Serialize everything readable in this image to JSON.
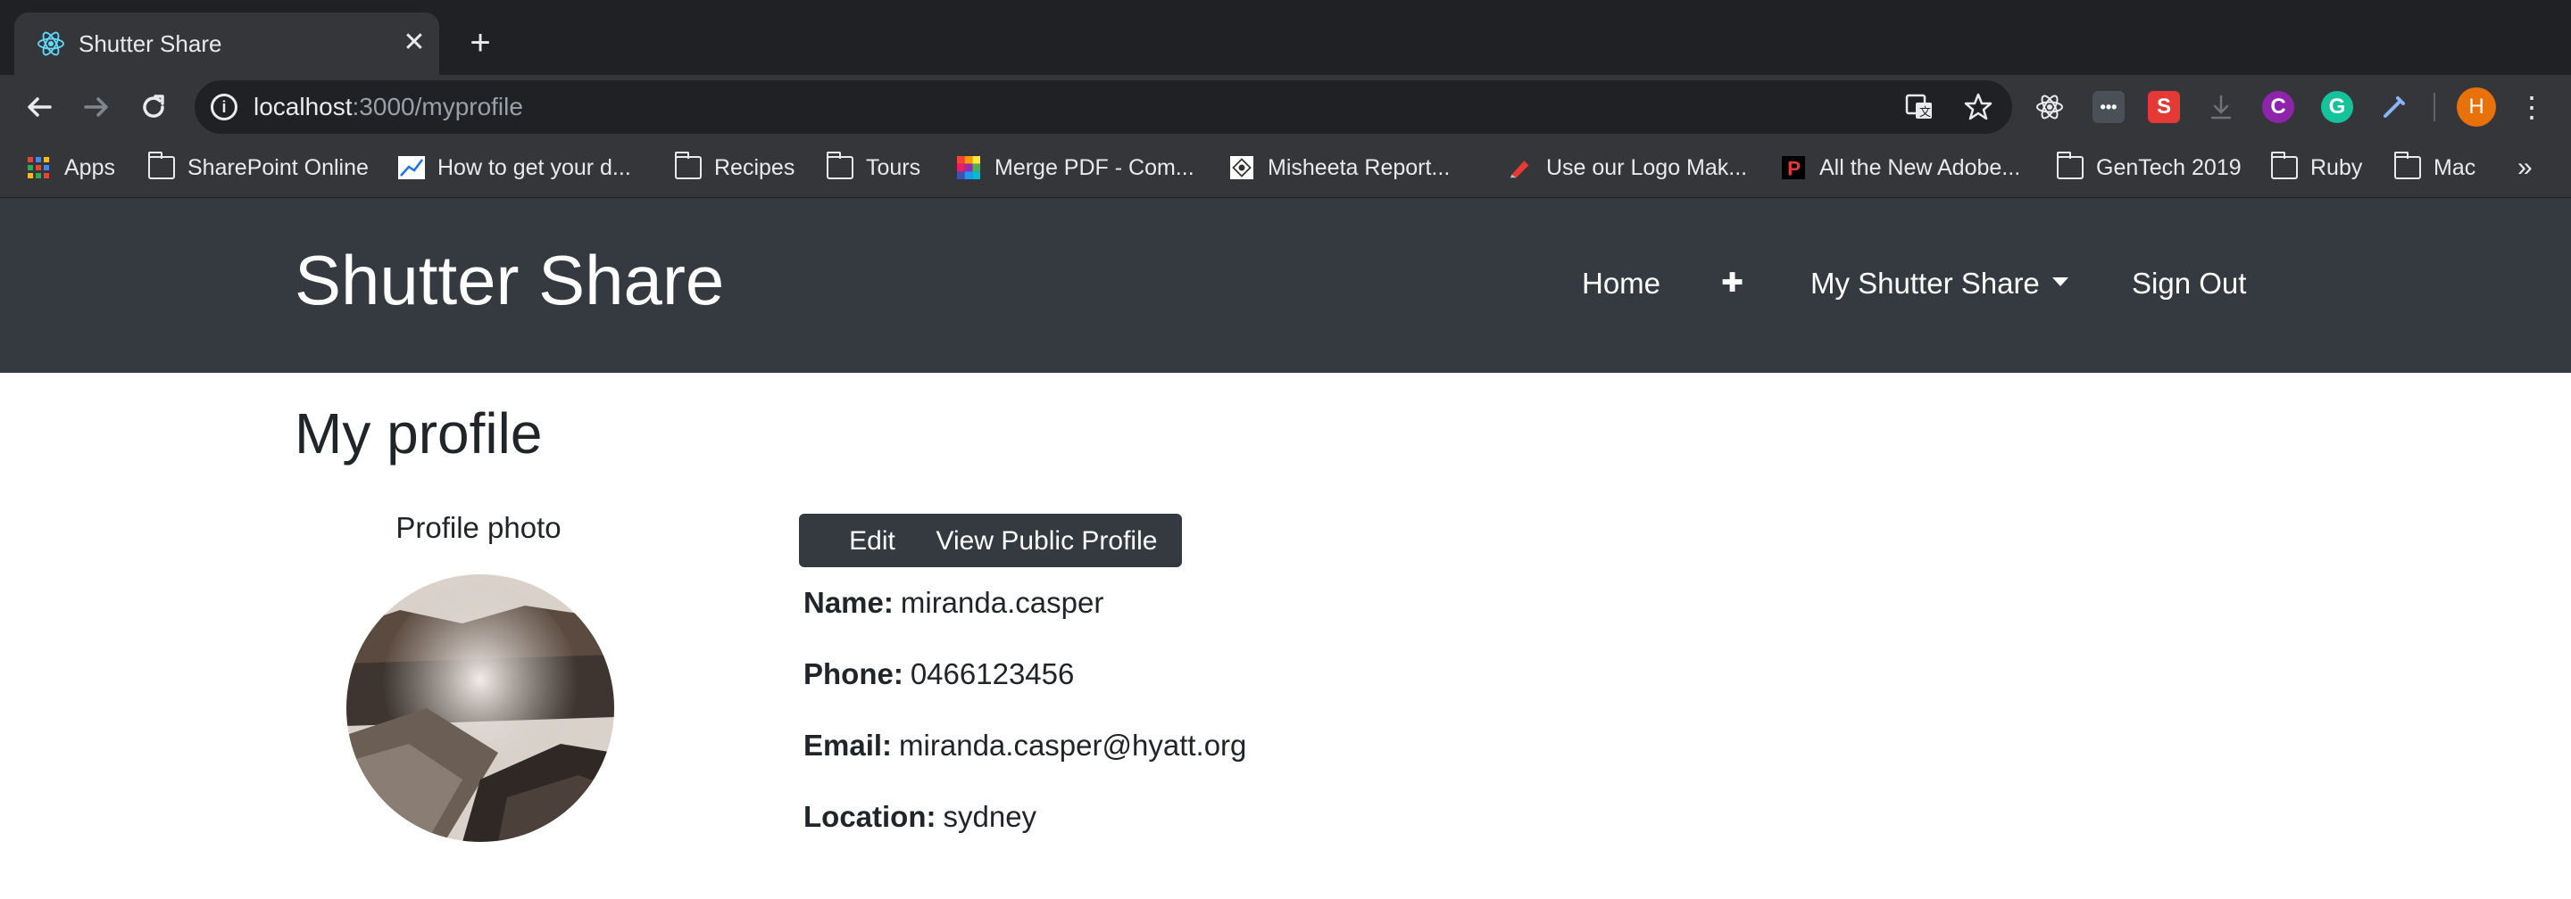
{
  "browser": {
    "tab_title": "Shutter Share",
    "tab_close": "✕",
    "new_tab": "+",
    "url_host": "localhost",
    "url_path": ":3000/myprofile",
    "bookmarks": [
      {
        "label": "Apps",
        "icon": "apps-grid-icon"
      },
      {
        "label": "SharePoint Online",
        "icon": "folder-icon"
      },
      {
        "label": "How to get your d...",
        "icon": "chart-favicon"
      },
      {
        "label": "Recipes",
        "icon": "folder-icon"
      },
      {
        "label": "Tours",
        "icon": "folder-icon"
      },
      {
        "label": "Merge PDF - Com...",
        "icon": "color-grid-favicon"
      },
      {
        "label": "Misheeta Report...",
        "icon": "report-favicon"
      },
      {
        "label": "Use our Logo Mak...",
        "icon": "logo-maker-favicon"
      },
      {
        "label": "All the New Adobe...",
        "icon": "p-favicon"
      },
      {
        "label": "GenTech 2019",
        "icon": "folder-icon"
      },
      {
        "label": "Ruby",
        "icon": "folder-icon"
      },
      {
        "label": "Mac",
        "icon": "folder-icon"
      }
    ],
    "bookmarks_overflow": "»",
    "profile_initial": "H"
  },
  "nav": {
    "brand": "Shutter Share",
    "home": "Home",
    "add": "✚",
    "my_shutter_share": "My Shutter Share",
    "sign_out": "Sign Out"
  },
  "profile": {
    "heading": "My profile",
    "photo_label": "Profile photo",
    "edit_button": "Edit",
    "view_public_button": "View Public Profile",
    "name_label": "Name:",
    "name": "miranda.casper",
    "phone_label": "Phone:",
    "phone": "0466123456",
    "email_label": "Email:",
    "email": "miranda.casper@hyatt.org",
    "location_label": "Location:",
    "location": "sydney"
  },
  "colors": {
    "navbar": "#343a40",
    "chrome_dark": "#202124",
    "chrome_mid": "#35363a",
    "text": "#212529"
  }
}
